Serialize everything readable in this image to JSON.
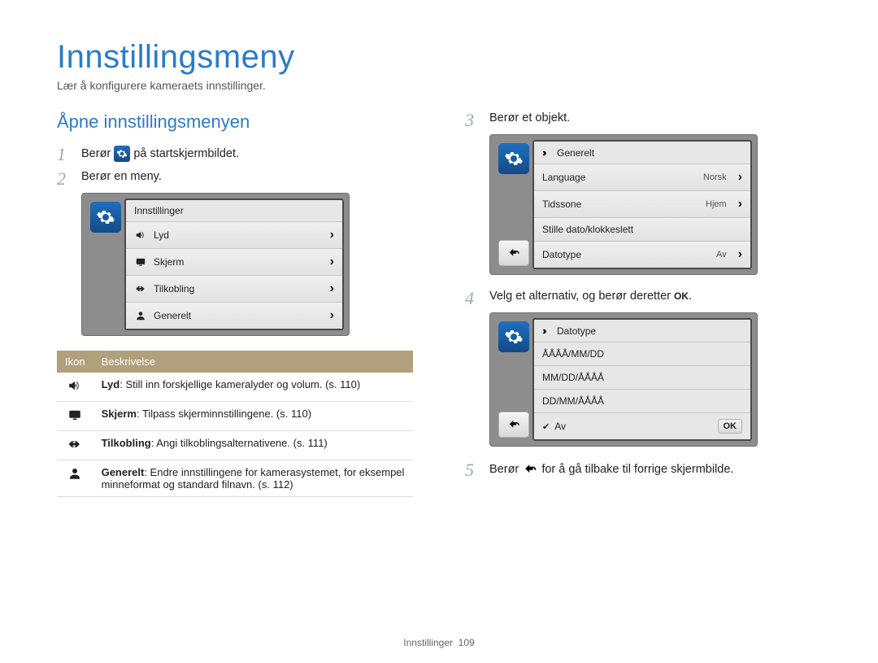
{
  "page": {
    "title": "Innstillingsmeny",
    "subtitle": "Lær å konfigurere kameraets innstillinger.",
    "footer_section": "Innstillinger",
    "footer_page": "109"
  },
  "left": {
    "section_heading": "Åpne innstillingsmenyen",
    "step1_pre": "Berør ",
    "step1_post": " på startskjermbildet.",
    "step2": "Berør en meny.",
    "screen": {
      "title": "Innstillinger",
      "rows": [
        {
          "icon": "sound",
          "label": "Lyd"
        },
        {
          "icon": "display",
          "label": "Skjerm"
        },
        {
          "icon": "connect",
          "label": "Tilkobling"
        },
        {
          "icon": "general",
          "label": "Generelt"
        }
      ]
    },
    "table": {
      "head_icon": "Ikon",
      "head_desc": "Beskrivelse",
      "rows": [
        {
          "icon": "sound",
          "term": "Lyd",
          "desc": ": Still inn forskjellige kameralyder og volum. (s. 110)"
        },
        {
          "icon": "display",
          "term": "Skjerm",
          "desc": ": Tilpass skjerminnstillingene. (s. 110)"
        },
        {
          "icon": "connect",
          "term": "Tilkobling",
          "desc": ": Angi tilkoblingsalternativene. (s. 111)"
        },
        {
          "icon": "general",
          "term": "Generelt",
          "desc": ": Endre innstillingene for kamerasystemet, for eksempel minneformat og standard filnavn. (s. 112)"
        }
      ]
    }
  },
  "right": {
    "step3": "Berør et objekt.",
    "screen3": {
      "title": "Generelt",
      "rows": [
        {
          "label": "Language",
          "value": "Norsk",
          "chev": true
        },
        {
          "label": "Tidssone",
          "value": "Hjem",
          "chev": true
        },
        {
          "label": "Stille dato/klokkeslett",
          "value": "",
          "chev": false
        },
        {
          "label": "Datotype",
          "value": "Av",
          "chev": true
        }
      ]
    },
    "step4_pre": "Velg et alternativ, og berør deretter ",
    "step4_ok": "OK",
    "step4_post": ".",
    "screen4": {
      "title": "Datotype",
      "options": [
        "ÅÅÅÅ/MM/DD",
        "MM/DD/ÅÅÅÅ",
        "DD/MM/ÅÅÅÅ"
      ],
      "selected": "Av",
      "ok_label": "OK"
    },
    "step5_pre": "Berør ",
    "step5_post": " for å gå tilbake til forrige skjermbilde."
  }
}
